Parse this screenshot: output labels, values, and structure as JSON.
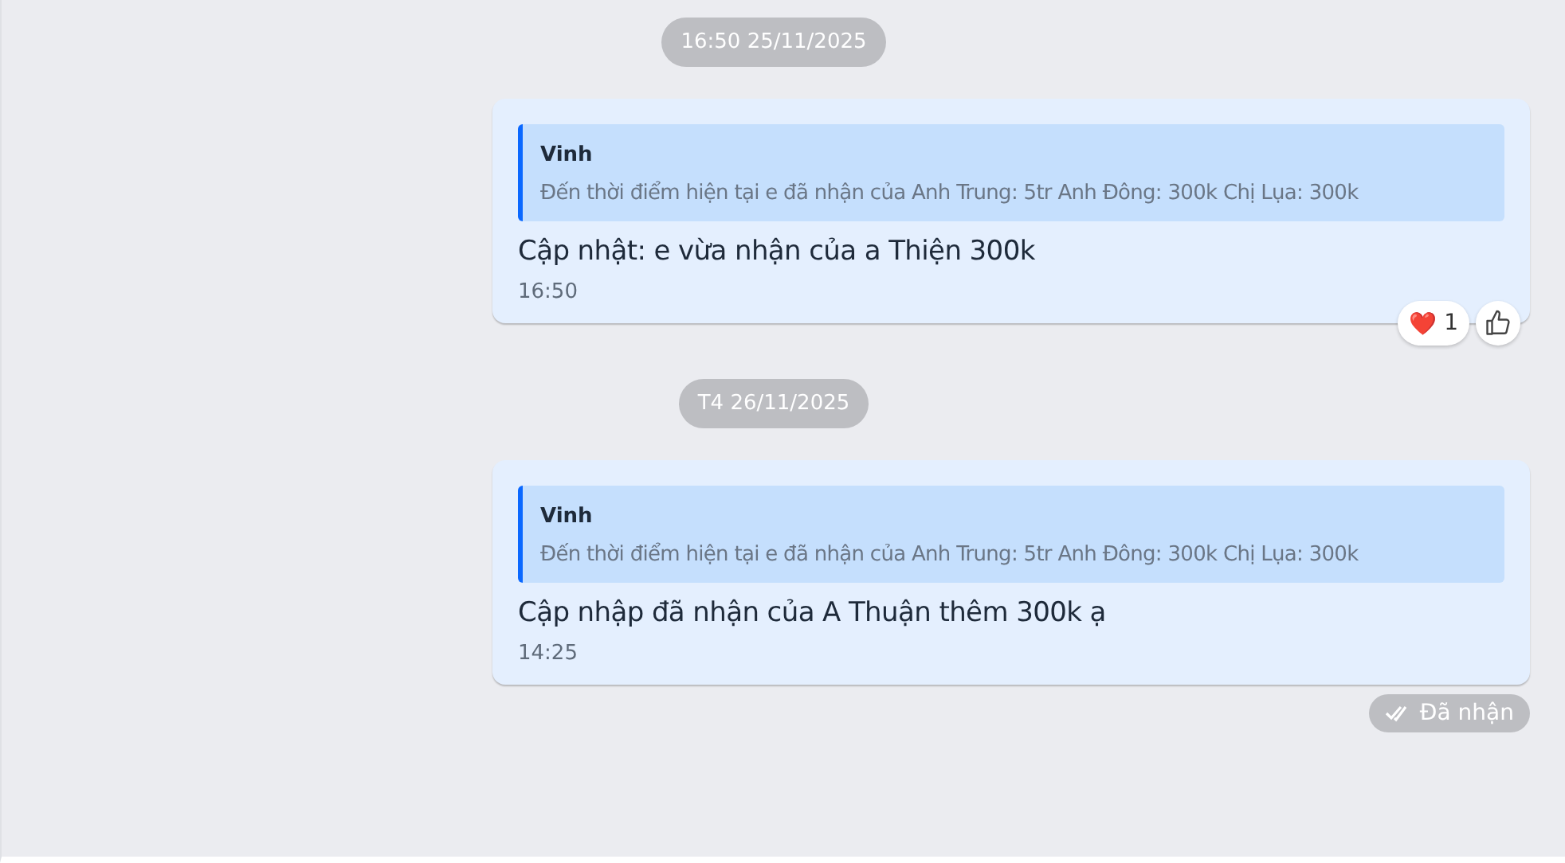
{
  "items": [
    {
      "kind": "date",
      "label": "16:50 25/11/2025"
    },
    {
      "kind": "message",
      "quote": {
        "author": "Vinh",
        "text": "Đến thời điểm hiện tại e đã nhận của Anh Trung: 5tr Anh Đông: 300k Chị Lụa: 300k"
      },
      "text": "Cập nhật: e vừa nhận của a Thiện 300k",
      "time": "16:50",
      "reactions": [
        {
          "emoji": "❤️",
          "count": "1"
        }
      ]
    },
    {
      "kind": "date",
      "label": "T4 26/11/2025"
    },
    {
      "kind": "message",
      "quote": {
        "author": "Vinh",
        "text": "Đến thời điểm hiện tại e đã nhận của Anh Trung: 5tr Anh Đông: 300k Chị Lụa: 300k"
      },
      "text": "Cập nhập đã nhận của A Thuận thêm 300k ạ",
      "time": "14:25",
      "status": "Đã nhận"
    }
  ]
}
